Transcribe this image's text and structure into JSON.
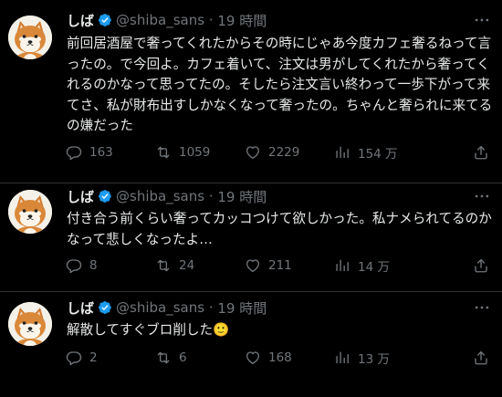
{
  "colors": {
    "background": "#000000",
    "text": "#e7e9ea",
    "muted": "#71767b",
    "verified": "#1d9bf0",
    "divider": "#2f3336"
  },
  "tweets": [
    {
      "name": "しば",
      "handle": "@shiba_sans",
      "time": "19 時間",
      "text": "前回居酒屋で奢ってくれたからその時にじゃあ今度カフェ奢るねって言ったの。で今回よ。カフェ着いて、注文は男がしてくれたから奢ってくれるのかなって思ってたの。そしたら注文言い終わって一歩下がって来てさ、私が財布出すしかなくなって奢ったの。ちゃんと奢られに来てるの嫌だった",
      "replies": "163",
      "retweets": "1059",
      "likes": "2229",
      "views": "154 万"
    },
    {
      "name": "しば",
      "handle": "@shiba_sans",
      "time": "19 時間",
      "text": "付き合う前くらい奢ってカッコつけて欲しかった。私ナメられてるのかなって悲しくなったよ…",
      "replies": "8",
      "retweets": "24",
      "likes": "211",
      "views": "14 万"
    },
    {
      "name": "しば",
      "handle": "@shiba_sans",
      "time": "19 時間",
      "text": "解散してすぐブロ削した🙂",
      "replies": "2",
      "retweets": "6",
      "likes": "168",
      "views": "13 万"
    }
  ],
  "icons": {
    "avatar": "shiba-dog-avatar",
    "verified": "verified-badge-icon",
    "more": "more-icon",
    "reply": "reply-icon",
    "retweet": "retweet-icon",
    "like": "heart-icon",
    "views": "views-icon",
    "share": "share-icon"
  }
}
